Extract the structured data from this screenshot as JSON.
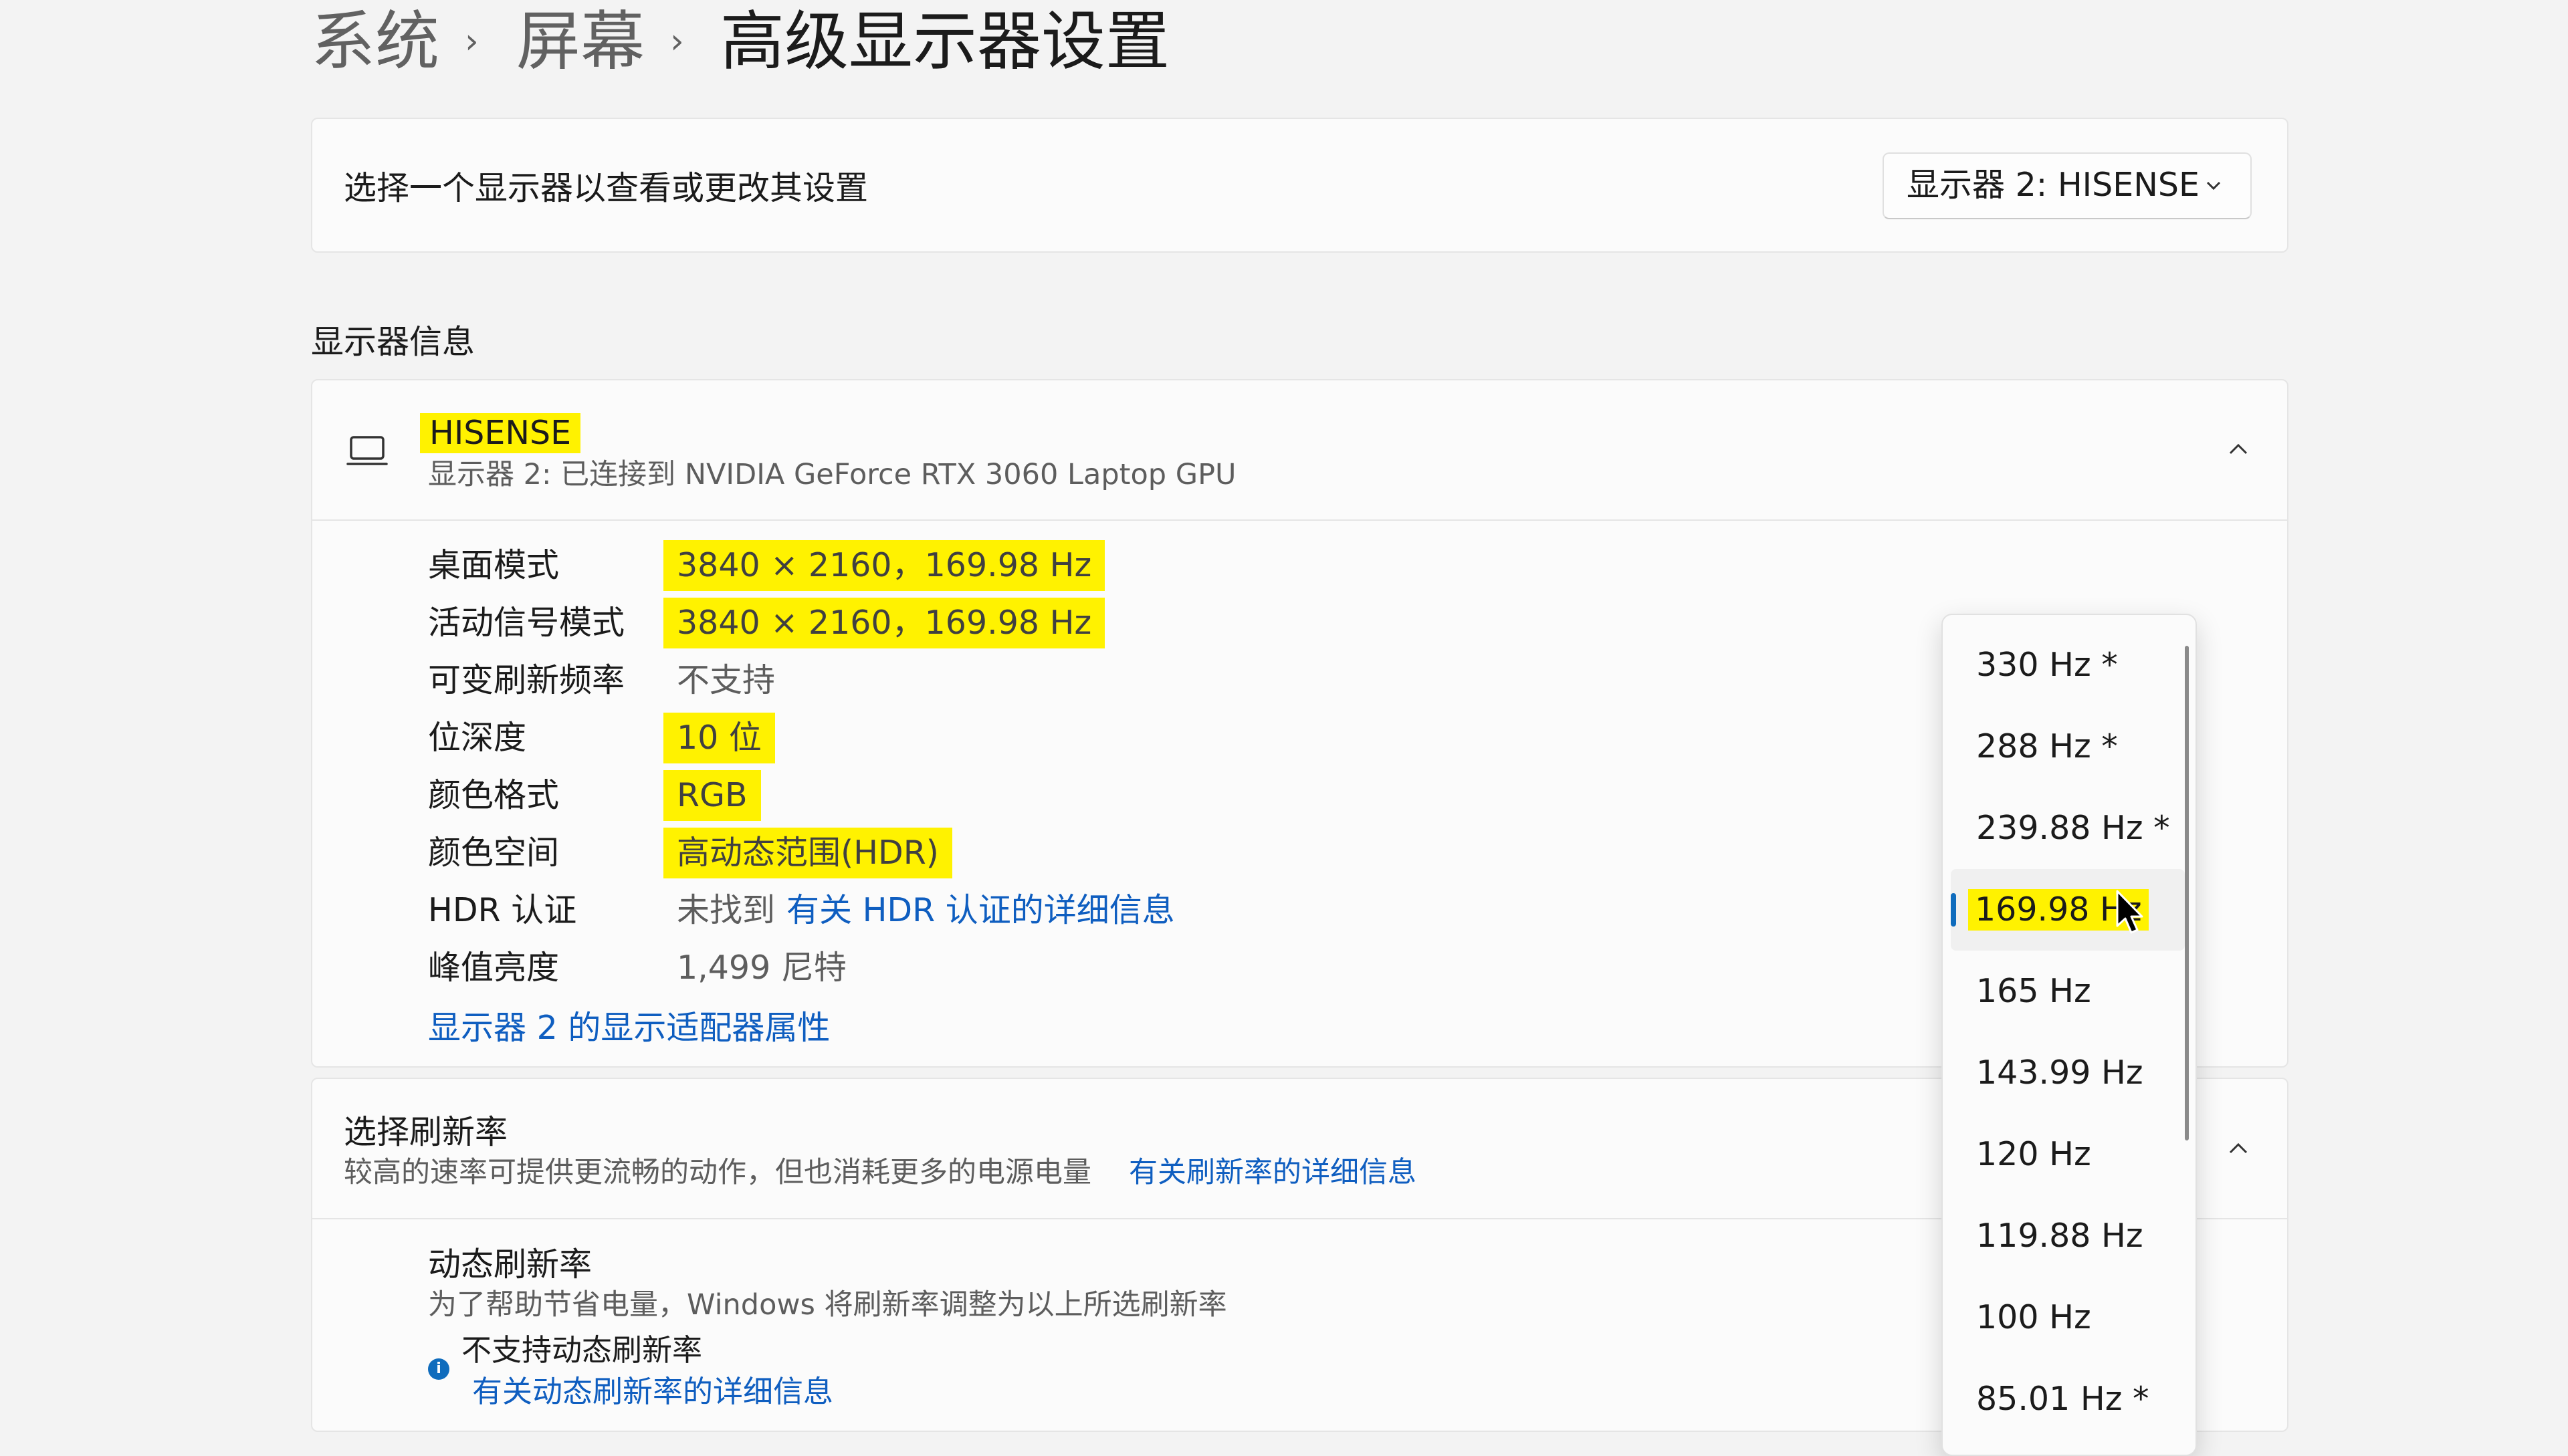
{
  "breadcrumb": {
    "items": [
      "系统",
      "屏幕",
      "高级显示器设置"
    ],
    "separator": "›"
  },
  "display_select": {
    "label": "选择一个显示器以查看或更改其设置",
    "value": "显示器 2: HISENSE"
  },
  "section_title": "显示器信息",
  "display_card": {
    "name": "HISENSE",
    "subtitle": "显示器 2: 已连接到 NVIDIA GeForce RTX 3060 Laptop GPU",
    "rows": [
      {
        "key": "桌面模式",
        "value": "3840 × 2160，169.98 Hz",
        "highlight": true
      },
      {
        "key": "活动信号模式",
        "value": "3840 × 2160，169.98 Hz",
        "highlight": true
      },
      {
        "key": "可变刷新频率",
        "value": "不支持",
        "highlight": false
      },
      {
        "key": "位深度",
        "value": "10 位",
        "highlight": true
      },
      {
        "key": "颜色格式",
        "value": "RGB",
        "highlight": true
      },
      {
        "key": "颜色空间",
        "value": "高动态范围(HDR)",
        "highlight": true
      },
      {
        "key": "HDR 认证",
        "value": "未找到",
        "link": "有关 HDR 认证的详细信息"
      },
      {
        "key": "峰值亮度",
        "value": "1,499 尼特",
        "highlight": false
      }
    ],
    "adapter_link": "显示器 2 的显示适配器属性"
  },
  "refresh_card": {
    "title": "选择刷新率",
    "desc": "较高的速率可提供更流畅的动作，但也消耗更多的电源电量",
    "desc_link": "有关刷新率的详细信息",
    "dynamic_title": "动态刷新率",
    "dynamic_desc": "为了帮助节省电量，Windows 将刷新率调整为以上所选刷新率",
    "unsupported": "不支持动态刷新率",
    "dynamic_link": "有关动态刷新率的详细信息"
  },
  "refresh_options": {
    "items": [
      "330 Hz *",
      "288 Hz *",
      "239.88 Hz *",
      "169.98 Hz",
      "165 Hz",
      "143.99 Hz",
      "120 Hz",
      "119.88 Hz",
      "100 Hz",
      "85.01 Hz *"
    ],
    "selected": "169.98 Hz"
  },
  "colors": {
    "highlight": "#fff200",
    "link": "#0f5ec0",
    "accent": "#0f6cbd"
  },
  "icons": [
    "laptop-icon",
    "chevron-down-icon",
    "chevron-up-icon",
    "info-icon",
    "cursor-icon"
  ]
}
